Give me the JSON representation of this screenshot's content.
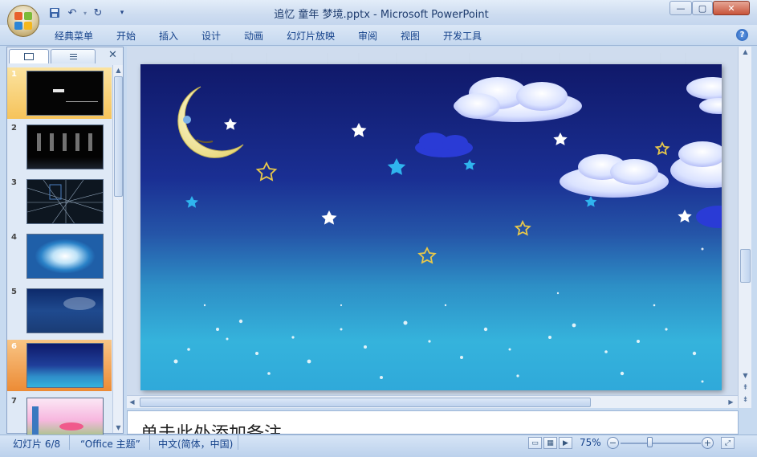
{
  "window": {
    "title": "追忆 童年 梦境.pptx - Microsoft PowerPoint",
    "buttons": {
      "minimize": "—",
      "maximize": "▢",
      "close": "✕"
    }
  },
  "qat": {
    "save_icon": "save-icon",
    "undo_icon": "undo-icon",
    "redo_icon": "redo-icon",
    "customize_icon": "customize-icon"
  },
  "menu": [
    "经典菜单",
    "开始",
    "插入",
    "设计",
    "动画",
    "幻灯片放映",
    "审阅",
    "视图",
    "开发工具"
  ],
  "help_icon": "?",
  "panel": {
    "tab_slides_icon": "slides-tab-icon",
    "tab_outline_icon": "outline-tab-icon",
    "close": "✕",
    "thumbnails": [
      {
        "num": "1",
        "state": "selected"
      },
      {
        "num": "2",
        "state": "normal"
      },
      {
        "num": "3",
        "state": "normal"
      },
      {
        "num": "4",
        "state": "normal"
      },
      {
        "num": "5",
        "state": "normal"
      },
      {
        "num": "6",
        "state": "current"
      },
      {
        "num": "7",
        "state": "normal"
      }
    ]
  },
  "notes": {
    "placeholder": "单击此处添加备注"
  },
  "status": {
    "slide_info": "幻灯片 6/8",
    "theme": "“Office 主题”",
    "language": "中文(简体，中国)",
    "zoom_level": "75%",
    "zoom_fraction": 0.36
  },
  "colors": {
    "accent": "#15428b",
    "selected_thumb": "#f6c35a",
    "current_thumb": "#ec8b35"
  }
}
